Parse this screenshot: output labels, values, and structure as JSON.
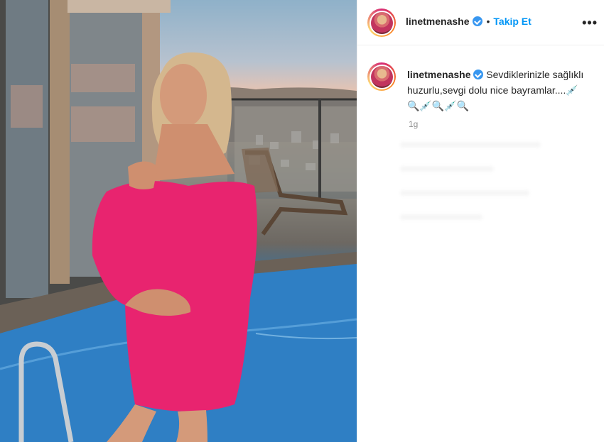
{
  "post": {
    "username": "linetmenashe",
    "separator": "•",
    "follow_label": "Takip Et",
    "more_label": "•••",
    "caption_line1": "Sevdiklerinizle sağlıklı",
    "caption_line2": "huzurlu,sevgi dolu nice bayramlar....💉",
    "caption_line3": "🔍💉🔍💉🔍",
    "time_ago": "1g"
  },
  "icons": {
    "verified": "verified-badge-icon",
    "more": "more-options-icon"
  },
  "colors": {
    "follow": "#0095f6",
    "verified": "#3897f0",
    "dress": "#e8246f"
  }
}
